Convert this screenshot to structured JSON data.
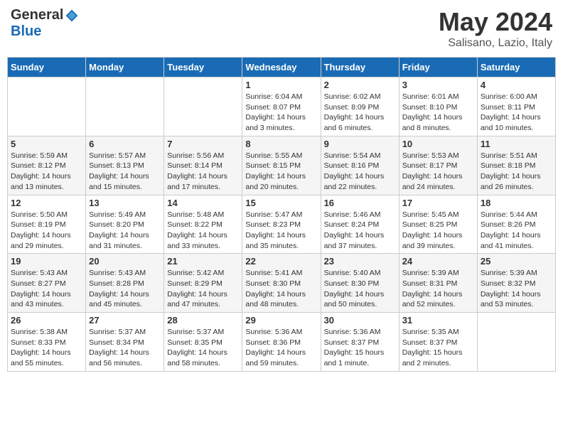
{
  "header": {
    "logo_general": "General",
    "logo_blue": "Blue",
    "month_title": "May 2024",
    "location": "Salisano, Lazio, Italy"
  },
  "days_of_week": [
    "Sunday",
    "Monday",
    "Tuesday",
    "Wednesday",
    "Thursday",
    "Friday",
    "Saturday"
  ],
  "weeks": [
    [
      {
        "day": "",
        "info": ""
      },
      {
        "day": "",
        "info": ""
      },
      {
        "day": "",
        "info": ""
      },
      {
        "day": "1",
        "info": "Sunrise: 6:04 AM\nSunset: 8:07 PM\nDaylight: 14 hours\nand 3 minutes."
      },
      {
        "day": "2",
        "info": "Sunrise: 6:02 AM\nSunset: 8:09 PM\nDaylight: 14 hours\nand 6 minutes."
      },
      {
        "day": "3",
        "info": "Sunrise: 6:01 AM\nSunset: 8:10 PM\nDaylight: 14 hours\nand 8 minutes."
      },
      {
        "day": "4",
        "info": "Sunrise: 6:00 AM\nSunset: 8:11 PM\nDaylight: 14 hours\nand 10 minutes."
      }
    ],
    [
      {
        "day": "5",
        "info": "Sunrise: 5:59 AM\nSunset: 8:12 PM\nDaylight: 14 hours\nand 13 minutes."
      },
      {
        "day": "6",
        "info": "Sunrise: 5:57 AM\nSunset: 8:13 PM\nDaylight: 14 hours\nand 15 minutes."
      },
      {
        "day": "7",
        "info": "Sunrise: 5:56 AM\nSunset: 8:14 PM\nDaylight: 14 hours\nand 17 minutes."
      },
      {
        "day": "8",
        "info": "Sunrise: 5:55 AM\nSunset: 8:15 PM\nDaylight: 14 hours\nand 20 minutes."
      },
      {
        "day": "9",
        "info": "Sunrise: 5:54 AM\nSunset: 8:16 PM\nDaylight: 14 hours\nand 22 minutes."
      },
      {
        "day": "10",
        "info": "Sunrise: 5:53 AM\nSunset: 8:17 PM\nDaylight: 14 hours\nand 24 minutes."
      },
      {
        "day": "11",
        "info": "Sunrise: 5:51 AM\nSunset: 8:18 PM\nDaylight: 14 hours\nand 26 minutes."
      }
    ],
    [
      {
        "day": "12",
        "info": "Sunrise: 5:50 AM\nSunset: 8:19 PM\nDaylight: 14 hours\nand 29 minutes."
      },
      {
        "day": "13",
        "info": "Sunrise: 5:49 AM\nSunset: 8:20 PM\nDaylight: 14 hours\nand 31 minutes."
      },
      {
        "day": "14",
        "info": "Sunrise: 5:48 AM\nSunset: 8:22 PM\nDaylight: 14 hours\nand 33 minutes."
      },
      {
        "day": "15",
        "info": "Sunrise: 5:47 AM\nSunset: 8:23 PM\nDaylight: 14 hours\nand 35 minutes."
      },
      {
        "day": "16",
        "info": "Sunrise: 5:46 AM\nSunset: 8:24 PM\nDaylight: 14 hours\nand 37 minutes."
      },
      {
        "day": "17",
        "info": "Sunrise: 5:45 AM\nSunset: 8:25 PM\nDaylight: 14 hours\nand 39 minutes."
      },
      {
        "day": "18",
        "info": "Sunrise: 5:44 AM\nSunset: 8:26 PM\nDaylight: 14 hours\nand 41 minutes."
      }
    ],
    [
      {
        "day": "19",
        "info": "Sunrise: 5:43 AM\nSunset: 8:27 PM\nDaylight: 14 hours\nand 43 minutes."
      },
      {
        "day": "20",
        "info": "Sunrise: 5:43 AM\nSunset: 8:28 PM\nDaylight: 14 hours\nand 45 minutes."
      },
      {
        "day": "21",
        "info": "Sunrise: 5:42 AM\nSunset: 8:29 PM\nDaylight: 14 hours\nand 47 minutes."
      },
      {
        "day": "22",
        "info": "Sunrise: 5:41 AM\nSunset: 8:30 PM\nDaylight: 14 hours\nand 48 minutes."
      },
      {
        "day": "23",
        "info": "Sunrise: 5:40 AM\nSunset: 8:30 PM\nDaylight: 14 hours\nand 50 minutes."
      },
      {
        "day": "24",
        "info": "Sunrise: 5:39 AM\nSunset: 8:31 PM\nDaylight: 14 hours\nand 52 minutes."
      },
      {
        "day": "25",
        "info": "Sunrise: 5:39 AM\nSunset: 8:32 PM\nDaylight: 14 hours\nand 53 minutes."
      }
    ],
    [
      {
        "day": "26",
        "info": "Sunrise: 5:38 AM\nSunset: 8:33 PM\nDaylight: 14 hours\nand 55 minutes."
      },
      {
        "day": "27",
        "info": "Sunrise: 5:37 AM\nSunset: 8:34 PM\nDaylight: 14 hours\nand 56 minutes."
      },
      {
        "day": "28",
        "info": "Sunrise: 5:37 AM\nSunset: 8:35 PM\nDaylight: 14 hours\nand 58 minutes."
      },
      {
        "day": "29",
        "info": "Sunrise: 5:36 AM\nSunset: 8:36 PM\nDaylight: 14 hours\nand 59 minutes."
      },
      {
        "day": "30",
        "info": "Sunrise: 5:36 AM\nSunset: 8:37 PM\nDaylight: 15 hours\nand 1 minute."
      },
      {
        "day": "31",
        "info": "Sunrise: 5:35 AM\nSunset: 8:37 PM\nDaylight: 15 hours\nand 2 minutes."
      },
      {
        "day": "",
        "info": ""
      }
    ]
  ]
}
